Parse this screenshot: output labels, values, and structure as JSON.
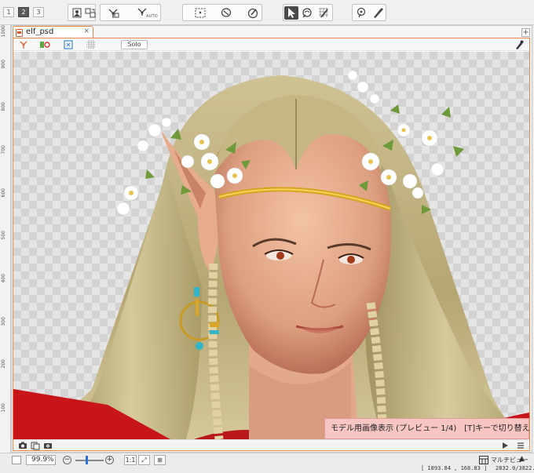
{
  "pages": [
    "1",
    "2",
    "3"
  ],
  "active_page": "2",
  "toolbar": {
    "auto_label": "AUTO"
  },
  "document": {
    "tab_title": "elf_psd",
    "tab_close": "×",
    "add_tab": "+",
    "solo_label": "Solo"
  },
  "ruler": {
    "labels": [
      "1000",
      "900",
      "800",
      "700",
      "600",
      "500",
      "400",
      "300",
      "200",
      "100"
    ]
  },
  "preview_banner": "モデル用画像表示 (プレビュー 1/4)　[T]キーで切り替え",
  "status": {
    "zoom": "99.9%",
    "scale_button": "1:1",
    "mode_label": "マルチビュー",
    "mode_arrow": "▲",
    "coords": "[ 1893.84 ,  168.83 ]",
    "size": "2832.0/3822."
  },
  "colors": {
    "accent_orange": "#e8884a",
    "banner_pink": "#f7c6c3",
    "slider_blue": "#2a6fd6"
  },
  "icons": [
    "art-mesh-icon",
    "deformer-icon",
    "auto-deformer-icon",
    "select-grid-icon",
    "lasso-icon",
    "brush-icon",
    "arrow-select-icon",
    "rotate-icon",
    "mesh-edit-icon",
    "pin-icon",
    "pen-icon"
  ]
}
